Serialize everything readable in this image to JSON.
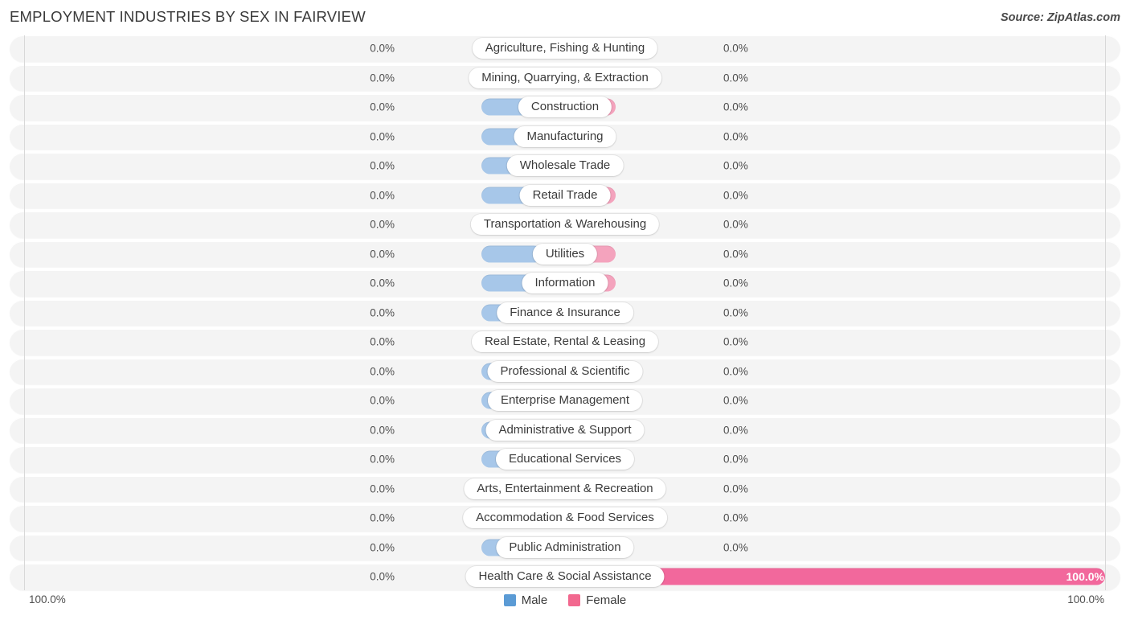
{
  "header": {
    "title": "EMPLOYMENT INDUSTRIES BY SEX IN FAIRVIEW",
    "source": "Source: ZipAtlas.com"
  },
  "legend": {
    "male_label": "Male",
    "female_label": "Female",
    "male_color": "#5b9bd5",
    "female_color": "#f2688f"
  },
  "axis": {
    "left_end": "100.0%",
    "right_end": "100.0%"
  },
  "chart_data": {
    "type": "bar",
    "title": "EMPLOYMENT INDUSTRIES BY SEX IN FAIRVIEW",
    "subtitle": "",
    "xlabel": "",
    "ylabel": "",
    "orientation": "horizontal-diverging",
    "xlim": [
      0,
      100
    ],
    "grid": false,
    "legend_position": "bottom-center",
    "categories": [
      "Agriculture, Fishing & Hunting",
      "Mining, Quarrying, & Extraction",
      "Construction",
      "Manufacturing",
      "Wholesale Trade",
      "Retail Trade",
      "Transportation & Warehousing",
      "Utilities",
      "Information",
      "Finance & Insurance",
      "Real Estate, Rental & Leasing",
      "Professional & Scientific",
      "Enterprise Management",
      "Administrative & Support",
      "Educational Services",
      "Arts, Entertainment & Recreation",
      "Accommodation & Food Services",
      "Public Administration",
      "Health Care & Social Assistance"
    ],
    "series": [
      {
        "name": "Male",
        "color": "#a7c7e9",
        "values": [
          0.0,
          0.0,
          0.0,
          0.0,
          0.0,
          0.0,
          0.0,
          0.0,
          0.0,
          0.0,
          0.0,
          0.0,
          0.0,
          0.0,
          0.0,
          0.0,
          0.0,
          0.0,
          0.0
        ],
        "labels": [
          "0.0%",
          "0.0%",
          "0.0%",
          "0.0%",
          "0.0%",
          "0.0%",
          "0.0%",
          "0.0%",
          "0.0%",
          "0.0%",
          "0.0%",
          "0.0%",
          "0.0%",
          "0.0%",
          "0.0%",
          "0.0%",
          "0.0%",
          "0.0%",
          "0.0%"
        ]
      },
      {
        "name": "Female",
        "color": "#f4a3bd",
        "values": [
          0.0,
          0.0,
          0.0,
          0.0,
          0.0,
          0.0,
          0.0,
          0.0,
          0.0,
          0.0,
          0.0,
          0.0,
          0.0,
          0.0,
          0.0,
          0.0,
          0.0,
          0.0,
          100.0
        ],
        "labels": [
          "0.0%",
          "0.0%",
          "0.0%",
          "0.0%",
          "0.0%",
          "0.0%",
          "0.0%",
          "0.0%",
          "0.0%",
          "0.0%",
          "0.0%",
          "0.0%",
          "0.0%",
          "0.0%",
          "0.0%",
          "0.0%",
          "0.0%",
          "0.0%",
          "100.0%"
        ]
      }
    ]
  },
  "rows": [
    {
      "label": "Agriculture, Fishing & Hunting",
      "male": "0.0%",
      "female": "0.0%",
      "female_pct": 0,
      "female_inside": false
    },
    {
      "label": "Mining, Quarrying, & Extraction",
      "male": "0.0%",
      "female": "0.0%",
      "female_pct": 0,
      "female_inside": false
    },
    {
      "label": "Construction",
      "male": "0.0%",
      "female": "0.0%",
      "female_pct": 0,
      "female_inside": false
    },
    {
      "label": "Manufacturing",
      "male": "0.0%",
      "female": "0.0%",
      "female_pct": 0,
      "female_inside": false
    },
    {
      "label": "Wholesale Trade",
      "male": "0.0%",
      "female": "0.0%",
      "female_pct": 0,
      "female_inside": false
    },
    {
      "label": "Retail Trade",
      "male": "0.0%",
      "female": "0.0%",
      "female_pct": 0,
      "female_inside": false
    },
    {
      "label": "Transportation & Warehousing",
      "male": "0.0%",
      "female": "0.0%",
      "female_pct": 0,
      "female_inside": false
    },
    {
      "label": "Utilities",
      "male": "0.0%",
      "female": "0.0%",
      "female_pct": 0,
      "female_inside": false
    },
    {
      "label": "Information",
      "male": "0.0%",
      "female": "0.0%",
      "female_pct": 0,
      "female_inside": false
    },
    {
      "label": "Finance & Insurance",
      "male": "0.0%",
      "female": "0.0%",
      "female_pct": 0,
      "female_inside": false
    },
    {
      "label": "Real Estate, Rental & Leasing",
      "male": "0.0%",
      "female": "0.0%",
      "female_pct": 0,
      "female_inside": false
    },
    {
      "label": "Professional & Scientific",
      "male": "0.0%",
      "female": "0.0%",
      "female_pct": 0,
      "female_inside": false
    },
    {
      "label": "Enterprise Management",
      "male": "0.0%",
      "female": "0.0%",
      "female_pct": 0,
      "female_inside": false
    },
    {
      "label": "Administrative & Support",
      "male": "0.0%",
      "female": "0.0%",
      "female_pct": 0,
      "female_inside": false
    },
    {
      "label": "Educational Services",
      "male": "0.0%",
      "female": "0.0%",
      "female_pct": 0,
      "female_inside": false
    },
    {
      "label": "Arts, Entertainment & Recreation",
      "male": "0.0%",
      "female": "0.0%",
      "female_pct": 0,
      "female_inside": false
    },
    {
      "label": "Accommodation & Food Services",
      "male": "0.0%",
      "female": "0.0%",
      "female_pct": 0,
      "female_inside": false
    },
    {
      "label": "Public Administration",
      "male": "0.0%",
      "female": "0.0%",
      "female_pct": 0,
      "female_inside": false
    },
    {
      "label": "Health Care & Social Assistance",
      "male": "0.0%",
      "female": "100.0%",
      "female_pct": 100,
      "female_inside": true
    }
  ]
}
